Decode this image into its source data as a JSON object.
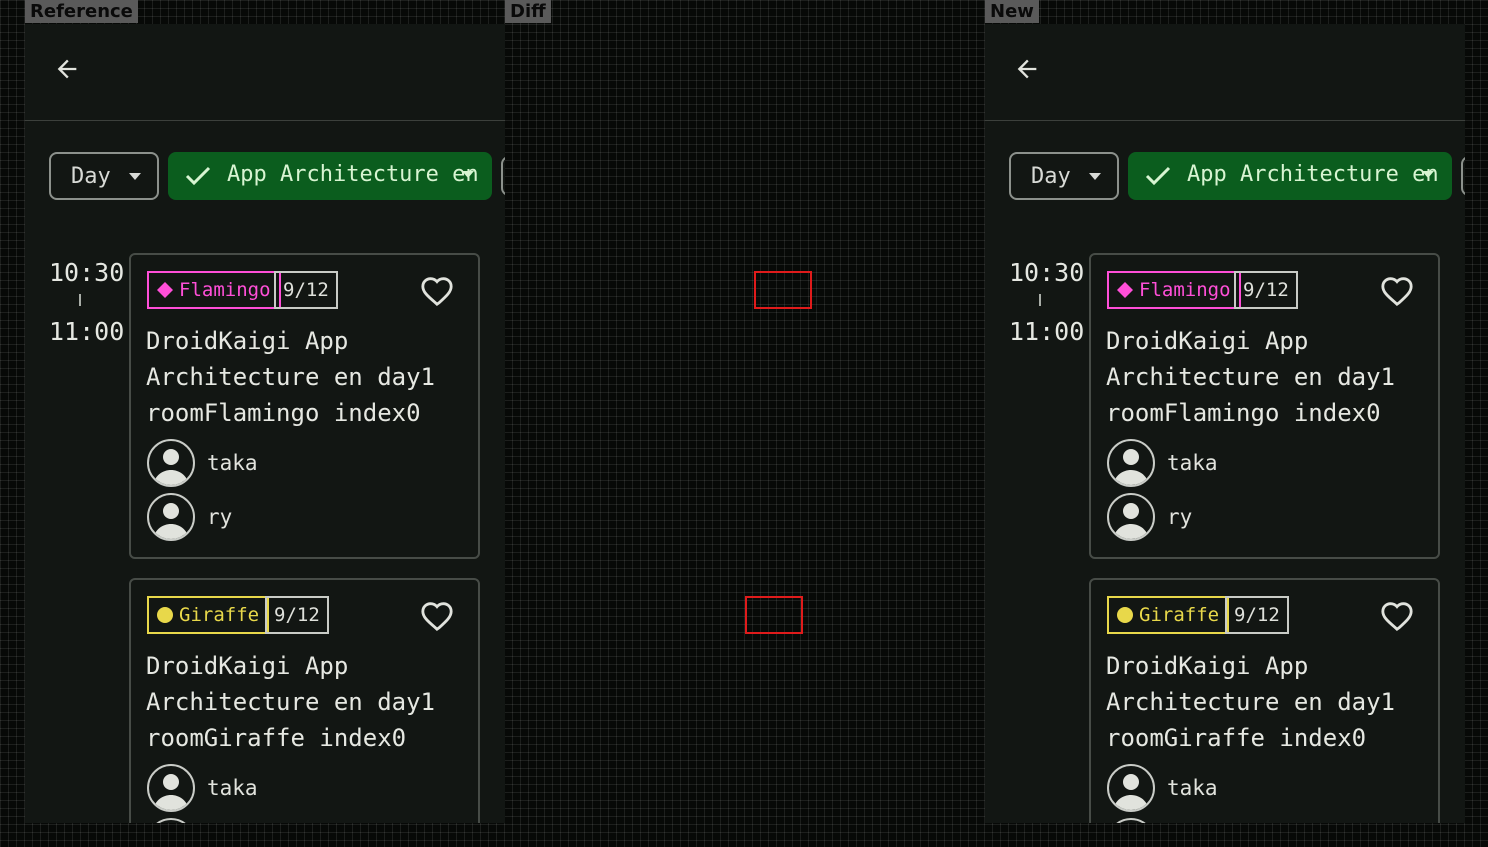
{
  "labels": {
    "reference": "Reference",
    "diff": "Diff",
    "new": "New"
  },
  "colors": {
    "background": "#121613",
    "selected_chip": "#0b5d1e",
    "flamingo": "#ff4fd8",
    "giraffe": "#e8d84a",
    "diff_marker": "#e01b1b"
  },
  "icons": {
    "back": "arrow-back-icon",
    "check": "check-icon",
    "dropdown": "dropdown-triangle-icon",
    "favorite": "heart-outline-icon",
    "avatar": "person-icon"
  },
  "filters": {
    "day_label": "Day",
    "category_label": "App Architecture en"
  },
  "timeslot": {
    "start": "10:30",
    "end": "11:00"
  },
  "sessions": [
    {
      "room": "Flamingo",
      "room_color": "#ff4fd8",
      "room_shape": "diamond",
      "date": "9/12",
      "title": "DroidKaigi App Architecture en day1 roomFlamingo index0",
      "speakers": [
        "taka",
        "ry"
      ]
    },
    {
      "room": "Giraffe",
      "room_color": "#e8d84a",
      "room_shape": "circle",
      "date": "9/12",
      "title": "DroidKaigi App Architecture en day1 roomGiraffe index0",
      "speakers": [
        "taka",
        ""
      ]
    }
  ]
}
